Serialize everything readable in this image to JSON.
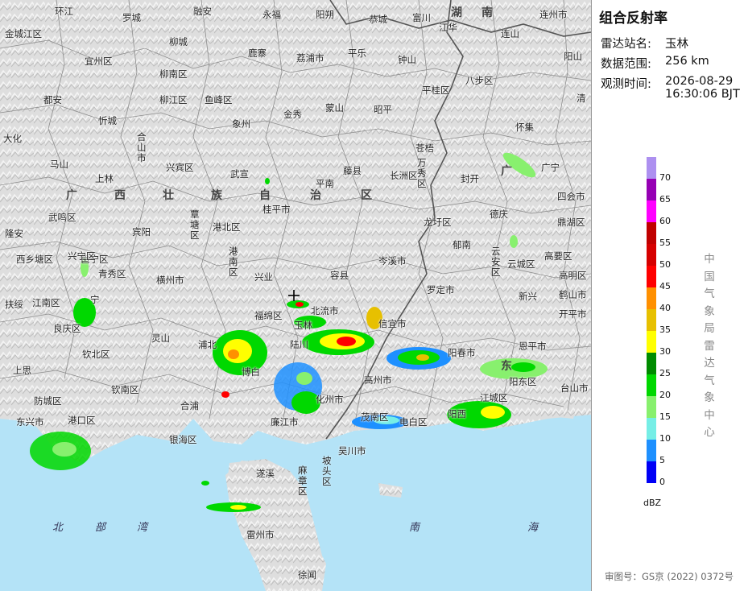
{
  "panel": {
    "title": "组合反射率",
    "station_label": "雷达站名:",
    "station_value": "玉林",
    "range_label": "数据范围:",
    "range_value": "256 km",
    "time_label": "观测时间:",
    "time_value_line1": "2026-08-29",
    "time_value_line2": "16:30:06 BJT",
    "agency_vertical": "中国气象局雷达气象中心",
    "approval": "审图号：GS京 (2022) 0372号"
  },
  "legend": {
    "unit": "dBZ",
    "ticks": [
      "70",
      "65",
      "60",
      "55",
      "50",
      "45",
      "40",
      "35",
      "30",
      "25",
      "20",
      "15",
      "10",
      "5",
      "0"
    ],
    "colors": [
      "#ad90f0",
      "#9600b4",
      "#ff00ff",
      "#c00000",
      "#d60000",
      "#ff0000",
      "#ff9000",
      "#e7c000",
      "#ffff00",
      "#008c00",
      "#00d800",
      "#88f06e",
      "#76eee6",
      "#1e90ff",
      "#0000f6"
    ]
  },
  "map": {
    "region_label": [
      "广",
      "西",
      "壮",
      "族",
      "自",
      "治",
      "区"
    ],
    "province_labels": [
      "湖",
      "南",
      "广",
      "东"
    ],
    "sea_label": [
      "北",
      "部",
      "湾",
      "南",
      "海"
    ],
    "cities": [
      "环江",
      "罗城",
      "融安",
      "永福",
      "阳朔",
      "恭城",
      "富川",
      "江华",
      "连州市",
      "金城江区",
      "宜州区",
      "柳城",
      "鹿寨",
      "荔浦市",
      "平乐",
      "钟山",
      "连山",
      "阳山",
      "柳南区",
      "都安",
      "柳江区",
      "鱼峰区",
      "象州",
      "金秀",
      "蒙山",
      "昭平",
      "八步区",
      "平桂区",
      "清",
      "大化",
      "忻城",
      "合山市",
      "怀集",
      "马山",
      "上林",
      "兴宾区",
      "武宣",
      "藤县",
      "苍梧",
      "万秀区",
      "封开",
      "广宁",
      "长洲区",
      "平南",
      "桂平市",
      "四会市",
      "武鸣区",
      "宾阳",
      "港北区",
      "龙圩区",
      "德庆",
      "鼎湖区",
      "隆安",
      "覃塘区",
      "岑溪市",
      "郁南",
      "云安区",
      "云城区",
      "高要区",
      "西乡塘区",
      "邕宁区",
      "青秀区",
      "横州市",
      "兴业",
      "容县",
      "高明区",
      "罗定市",
      "扶绥",
      "江南区",
      "宁",
      "福绵区",
      "北流市",
      "新兴",
      "鹤山市",
      "开平市",
      "良庆区",
      "灵山",
      "陆川",
      "信宜市",
      "阳春市",
      "恩平市",
      "上思",
      "钦北区",
      "浦北",
      "博白",
      "高州市",
      "阳东区",
      "台山市",
      "钦南区",
      "防城区",
      "合浦",
      "化州市",
      "江城区",
      "茂南区",
      "电白区",
      "阳西",
      "港口区",
      "银海区",
      "廉江市",
      "东兴市",
      "吴川市",
      "遂溪",
      "麻章区",
      "坡头区",
      "雷州市",
      "徐闻",
      "兴宁区",
      "港南区",
      "玉林"
    ]
  }
}
